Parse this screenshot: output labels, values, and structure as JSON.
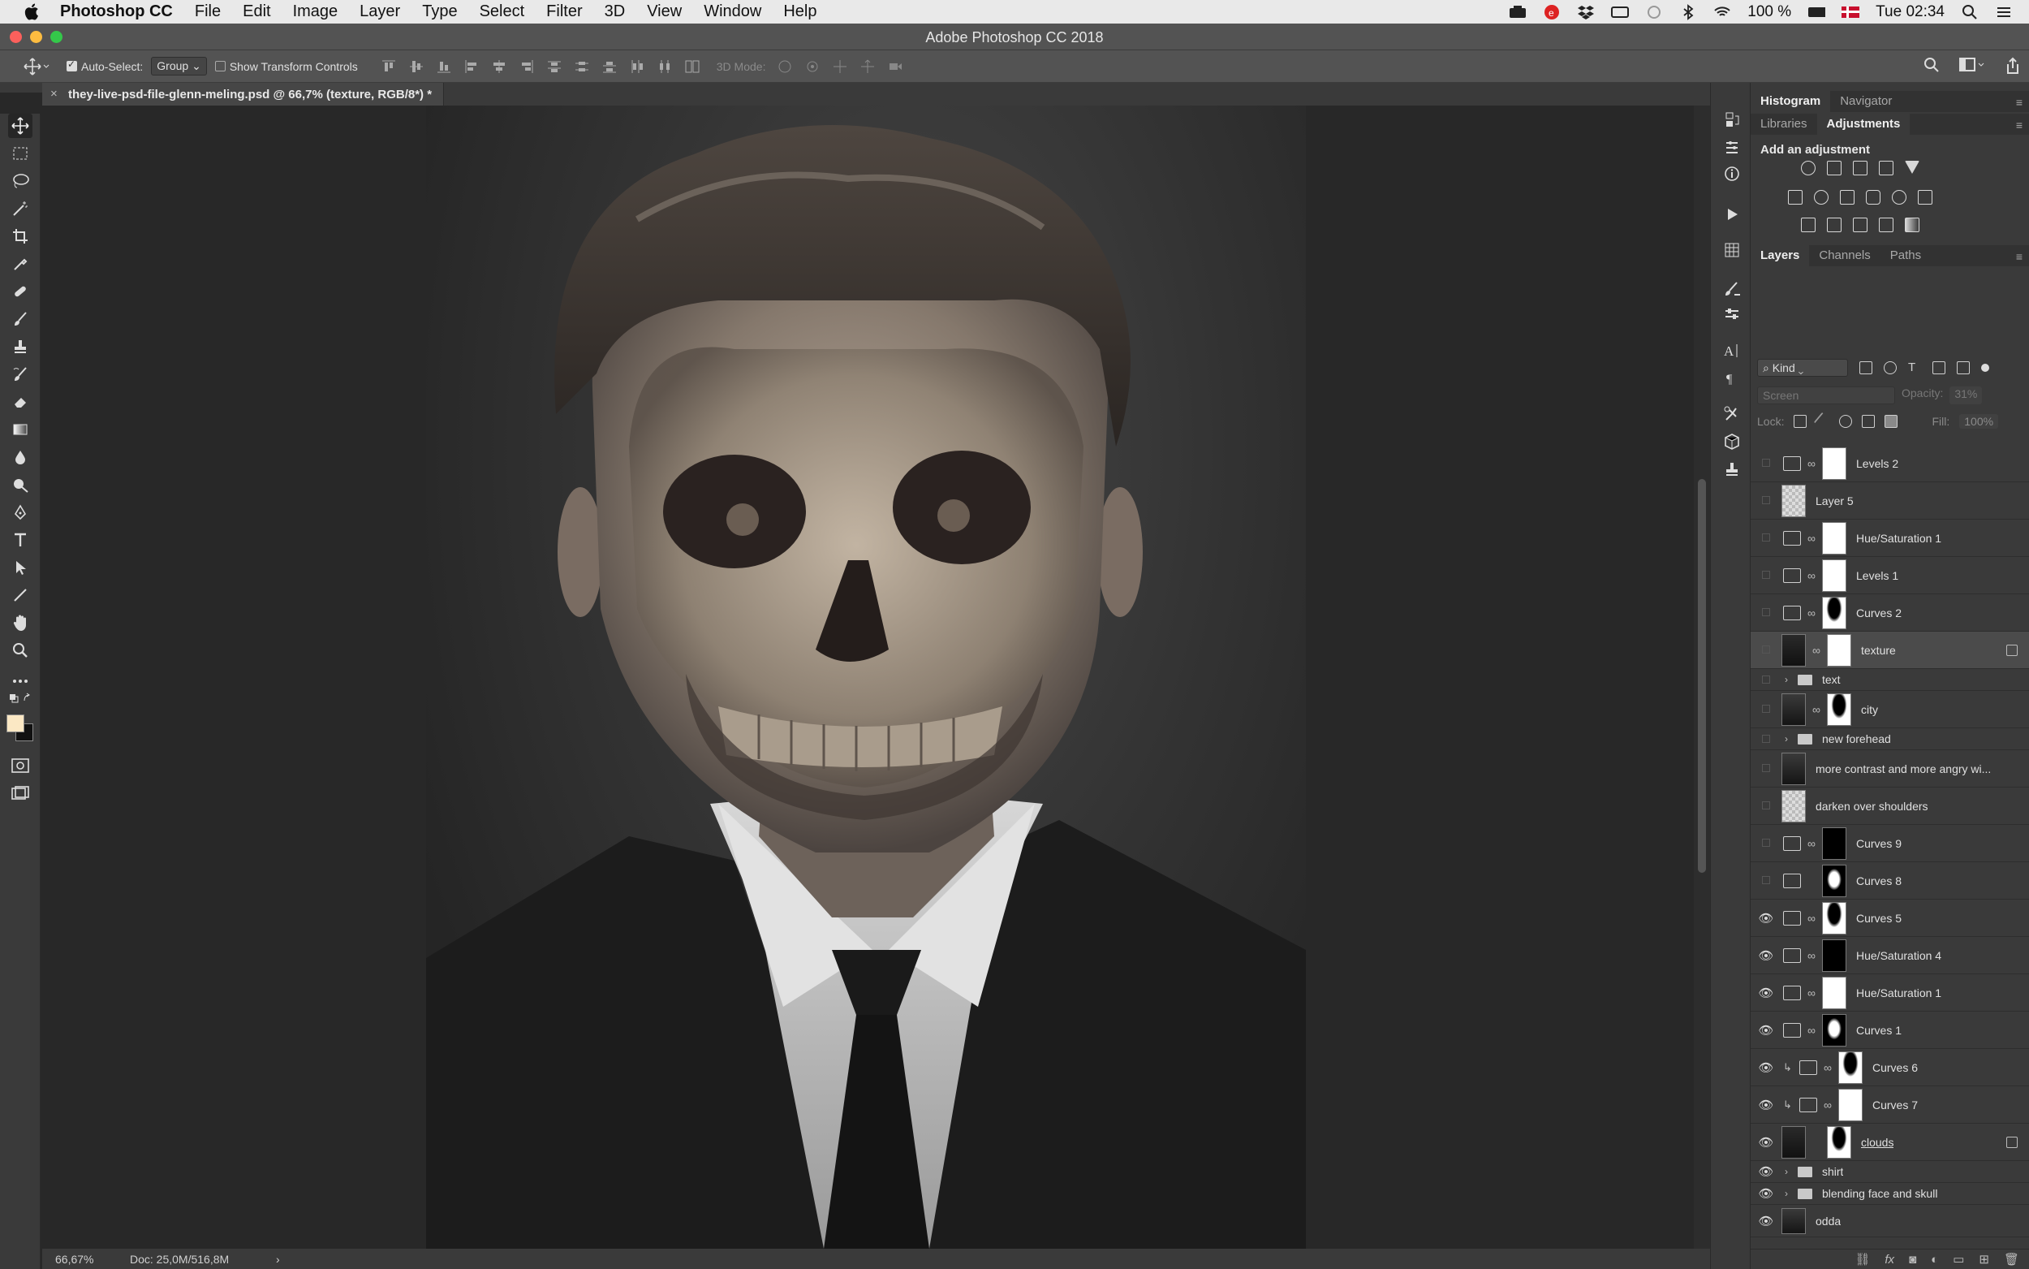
{
  "menubar": {
    "app_name": "Photoshop CC",
    "items": [
      "File",
      "Edit",
      "Image",
      "Layer",
      "Type",
      "Select",
      "Filter",
      "3D",
      "View",
      "Window",
      "Help"
    ],
    "battery": "100 %",
    "clock": "Tue 02:34"
  },
  "window": {
    "title": "Adobe Photoshop CC 2018"
  },
  "options": {
    "auto_select_label": "Auto-Select:",
    "auto_select_value": "Group",
    "transform_label": "Show Transform Controls",
    "mode3d_label": "3D Mode:"
  },
  "document": {
    "tab_close": "×",
    "tab_title": "they-live-psd-file-glenn-meling.psd @ 66,7% (texture, RGB/8*) *"
  },
  "status": {
    "zoom": "66,67%",
    "doc_size": "Doc: 25,0M/516,8M",
    "arrow": "›"
  },
  "panels": {
    "top_tabs": [
      "Histogram",
      "Navigator"
    ],
    "mid_tabs": [
      "Libraries",
      "Adjustments"
    ],
    "adjust_title": "Add an adjustment",
    "layer_tabs": [
      "Layers",
      "Channels",
      "Paths"
    ],
    "kind_label": "Kind",
    "blend_mode": "Screen",
    "opacity_label": "Opacity:",
    "opacity_value": "31%",
    "lock_label": "Lock:",
    "fill_label": "Fill:",
    "fill_value": "100%",
    "menu_glyph": "≡"
  },
  "layers": [
    {
      "name": "Levels 2",
      "visible": false
    },
    {
      "name": "Layer 5",
      "visible": false
    },
    {
      "name": "Hue/Saturation 1",
      "visible": false
    },
    {
      "name": "Levels 1",
      "visible": false
    },
    {
      "name": "Curves 2",
      "visible": false
    },
    {
      "name": "texture",
      "visible": false,
      "selected": true
    },
    {
      "name": "text",
      "visible": false
    },
    {
      "name": "city",
      "visible": false
    },
    {
      "name": "new forehead",
      "visible": false
    },
    {
      "name": "more contrast and more angry wi...",
      "visible": false
    },
    {
      "name": "darken over shoulders",
      "visible": false
    },
    {
      "name": "Curves 9",
      "visible": false
    },
    {
      "name": "Curves 8",
      "visible": false
    },
    {
      "name": "Curves 5",
      "visible": true
    },
    {
      "name": "Hue/Saturation 4",
      "visible": true
    },
    {
      "name": "Hue/Saturation 1",
      "visible": true
    },
    {
      "name": "Curves 1",
      "visible": true
    },
    {
      "name": "Curves 6",
      "visible": true
    },
    {
      "name": "Curves 7",
      "visible": true
    },
    {
      "name": "clouds",
      "visible": true
    },
    {
      "name": "shirt",
      "visible": true
    },
    {
      "name": "blending face and skull",
      "visible": true
    },
    {
      "name": "odda",
      "visible": true
    }
  ],
  "footer_icons": [
    "link-icon",
    "fx-icon",
    "mask-icon",
    "adjustment-icon",
    "folder-icon",
    "new-layer-icon",
    "trash-icon"
  ],
  "colors": {
    "foreground": "#fbe8c4",
    "background": "#111111",
    "accent": "#4b4b4b"
  }
}
